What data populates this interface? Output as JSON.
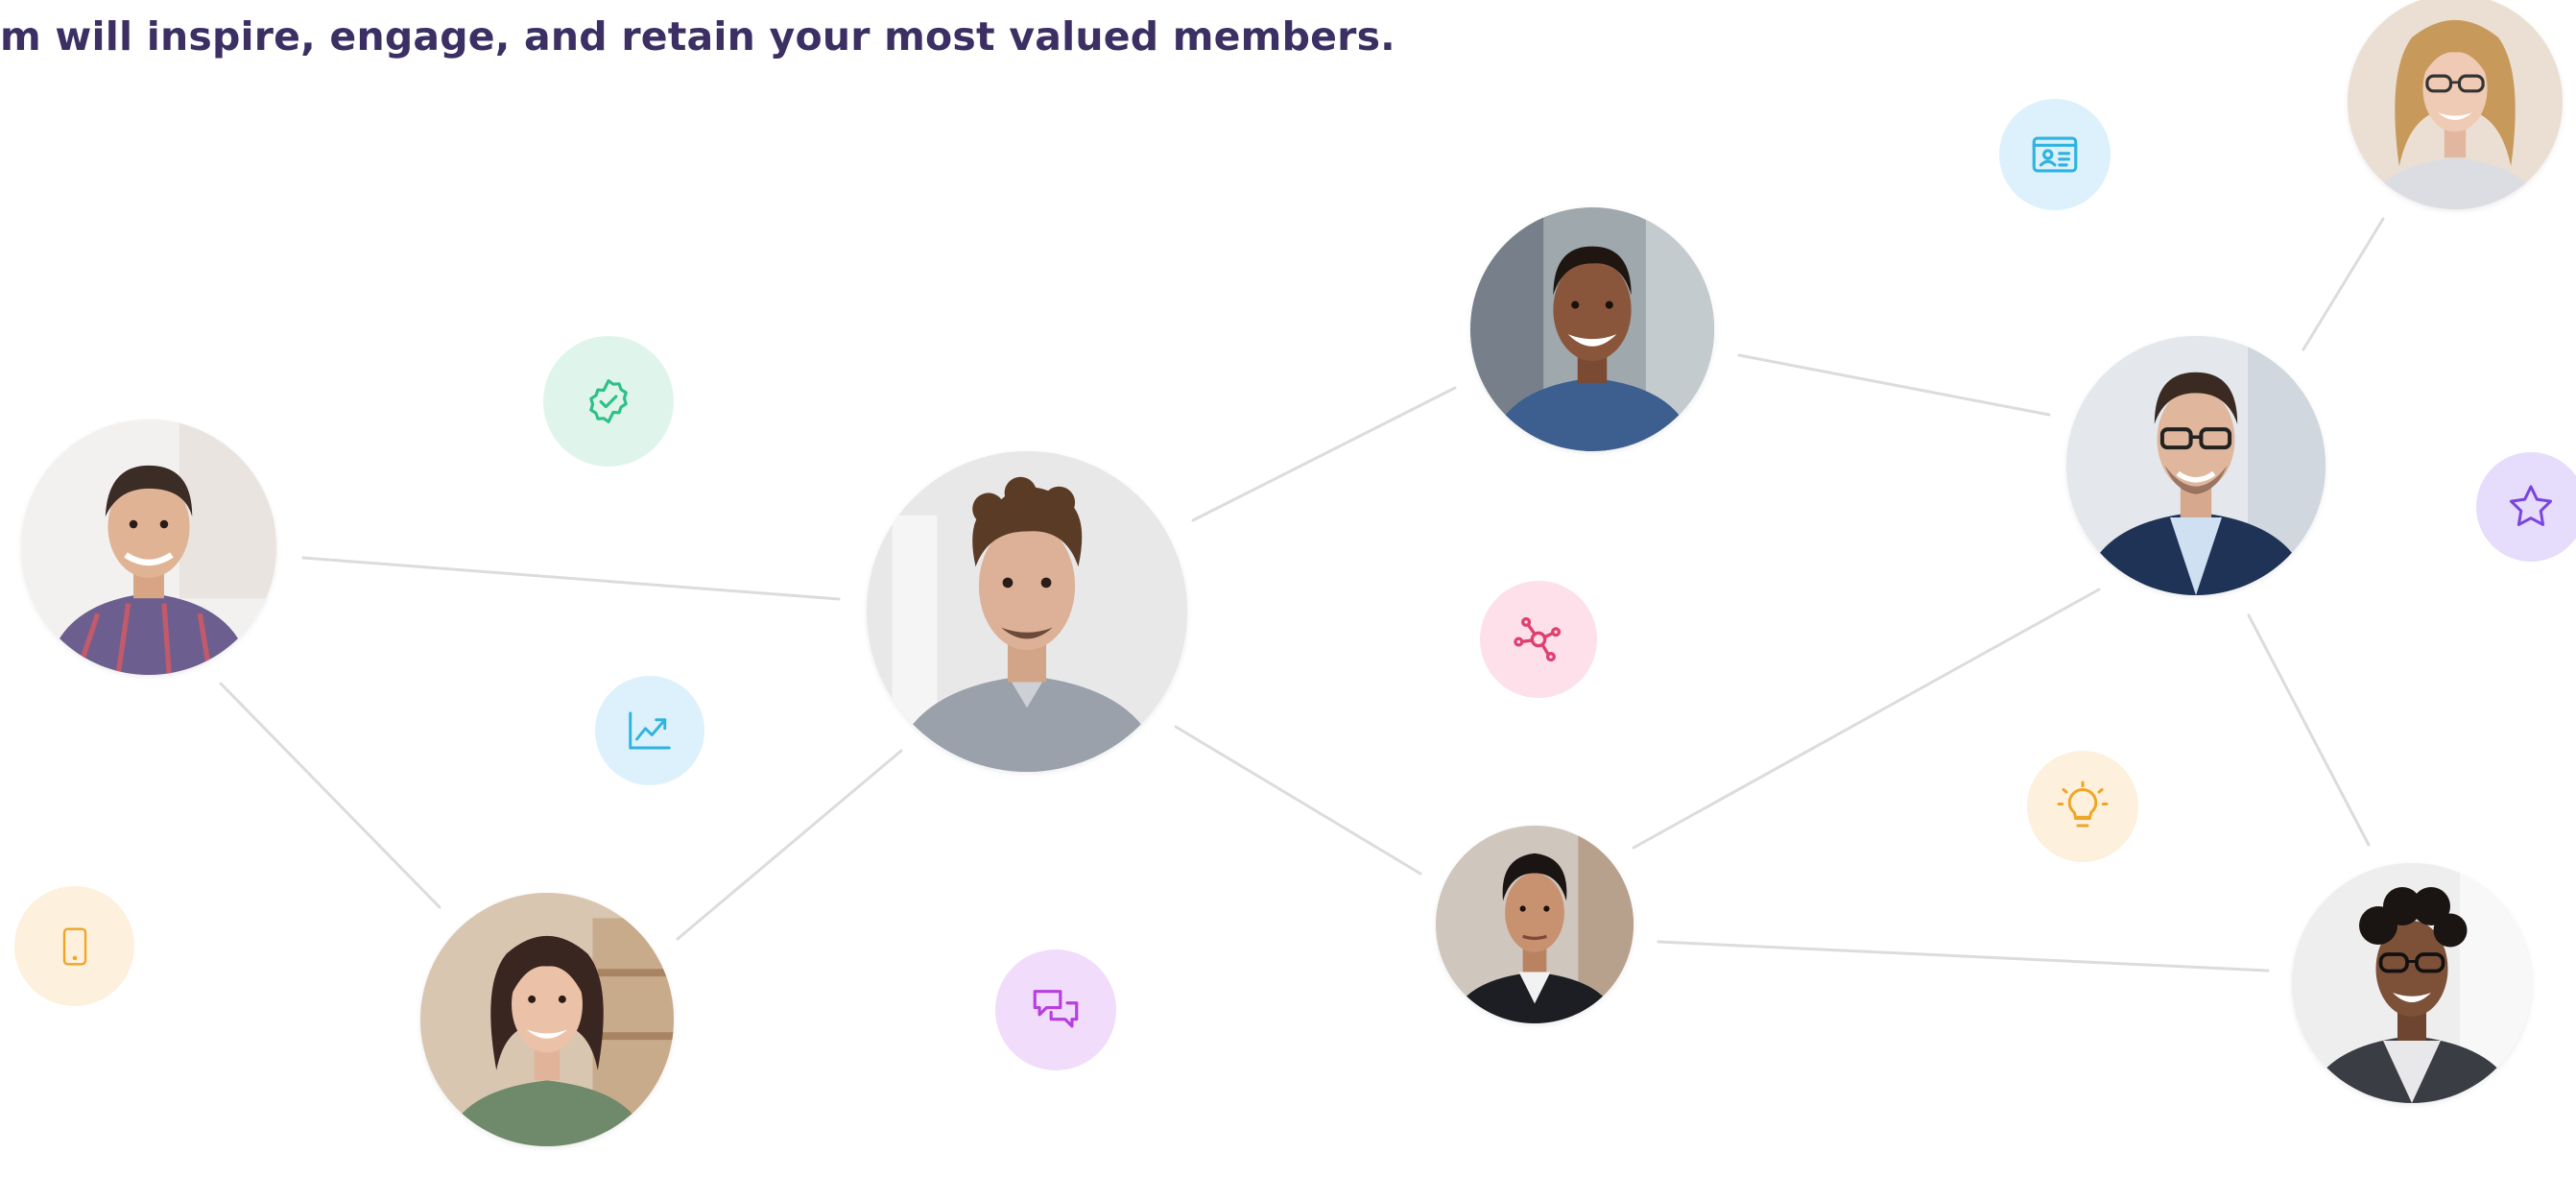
{
  "tagline": "m will inspire, engage, and retain your most valued members.",
  "colors": {
    "tagline_text": "#3b2f63",
    "connector_line": "#dcdcdc",
    "mint_badge": "#dff5ec",
    "mint_icon": "#2fbf88",
    "sky_badge": "#dcf1fb",
    "sky_icon": "#2fb3e0",
    "pink_badge": "#fde0ea",
    "pink_icon": "#e0406f",
    "peach_badge": "#fdf0dc",
    "peach_icon": "#f0a526",
    "lilac_badge": "#f1dcfb",
    "lilac_icon": "#b63fe0",
    "violet_badge": "#e6dcfb",
    "violet_icon": "#7a45e0"
  },
  "people": [
    {
      "name": "member-avatar-left-plaid-shirt"
    },
    {
      "name": "member-avatar-center-curly-hair"
    },
    {
      "name": "member-avatar-top-smiling-blue-shirt"
    },
    {
      "name": "member-avatar-bottom-left-woman"
    },
    {
      "name": "member-avatar-bottom-center-man"
    },
    {
      "name": "member-avatar-right-glasses-blazer"
    },
    {
      "name": "member-avatar-top-right-woman-glasses"
    },
    {
      "name": "member-avatar-bottom-right-woman-glasses"
    }
  ],
  "badges": [
    {
      "icon": "verified-check-icon"
    },
    {
      "icon": "growth-chart-icon"
    },
    {
      "icon": "mobile-phone-icon"
    },
    {
      "icon": "chat-bubbles-icon"
    },
    {
      "icon": "network-nodes-icon"
    },
    {
      "icon": "id-card-icon"
    },
    {
      "icon": "lightbulb-icon"
    },
    {
      "icon": "star-icon"
    }
  ]
}
